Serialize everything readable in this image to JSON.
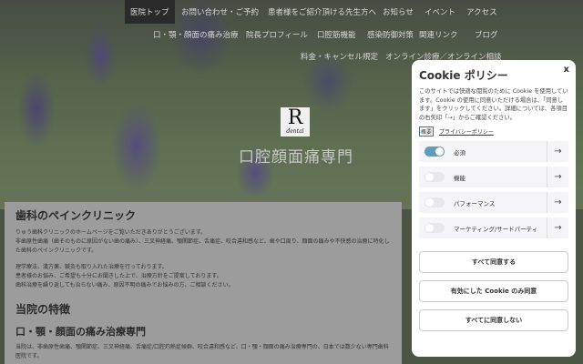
{
  "nav": {
    "row1": [
      "医院トップ",
      "お問い合わせ・ご予約",
      "患者様をご紹介頂ける先生方へ",
      "お知らせ",
      "イベント",
      "アクセス"
    ],
    "row2": [
      "口・顎・顔面の痛み治療",
      "院長プロフィール",
      "口腔筋機能",
      "感染防御対策",
      "関連リンク",
      "ブログ"
    ],
    "row3": [
      "料金・キャンセル規定",
      "オンライン診療／オンライン相談"
    ]
  },
  "hero": {
    "logo_letter": "R",
    "logo_sub": "dental",
    "title": "口腔顔面痛専門"
  },
  "main": {
    "h1": "歯科のペインクリニック",
    "p1": [
      "りゅう歯科クリニックのホームページをご覧いただきありがとうございます。",
      "非歯原性歯痛（歯そのものに原因がない歯の痛み）、三叉神経痛、顎関節症、舌痛症、咬合違和感など、歯や口周り、顔面の痛みや不快感の治療に特化した歯科のペインクリニックです。"
    ],
    "p2": [
      "理学療法、漢方薬、鍼灸も取り入れた治療を行っております。",
      "患者様のお悩み、ご希望も十分にお聞きした上で、治療方針をご提案しております。",
      "歯科治療を繰り返しても治らない痛み、原因不明の痛みでお悩みの方、ご相談ください。"
    ],
    "h2": "当院の特徴",
    "h3": "口・顎・顔面の痛み治療専門",
    "p3": "当院は、非歯原性歯痛、顎関節症、三叉神経痛、舌痛症/口腔灼熱症候群、咬合違和感など、口・顎・顔面の痛み治療専門の、日本では数少ない専門歯科医院です。"
  },
  "cookie": {
    "title": "Cookie ポリシー",
    "close": "x",
    "desc": "このサイトでは快適な閲覧のために Cookie を使用しています。Cookie の使用に同意いただける場合は、「同意します」をクリックしてください。詳細については、各項目の右矢印「→」からご確認ください。",
    "overview": "概要",
    "privacy": "プライバシーポリシー",
    "categories": [
      {
        "label": "必須",
        "enabled": true
      },
      {
        "label": "機能",
        "enabled": false
      },
      {
        "label": "パフォーマンス",
        "enabled": false
      },
      {
        "label": "マーケティング/サードパーティ",
        "enabled": false
      }
    ],
    "arrow": "→",
    "accept_all": "すべて同意する",
    "accept_selected": "有効にした Cookie のみ同意",
    "reject_all": "すべてに同意しない"
  }
}
